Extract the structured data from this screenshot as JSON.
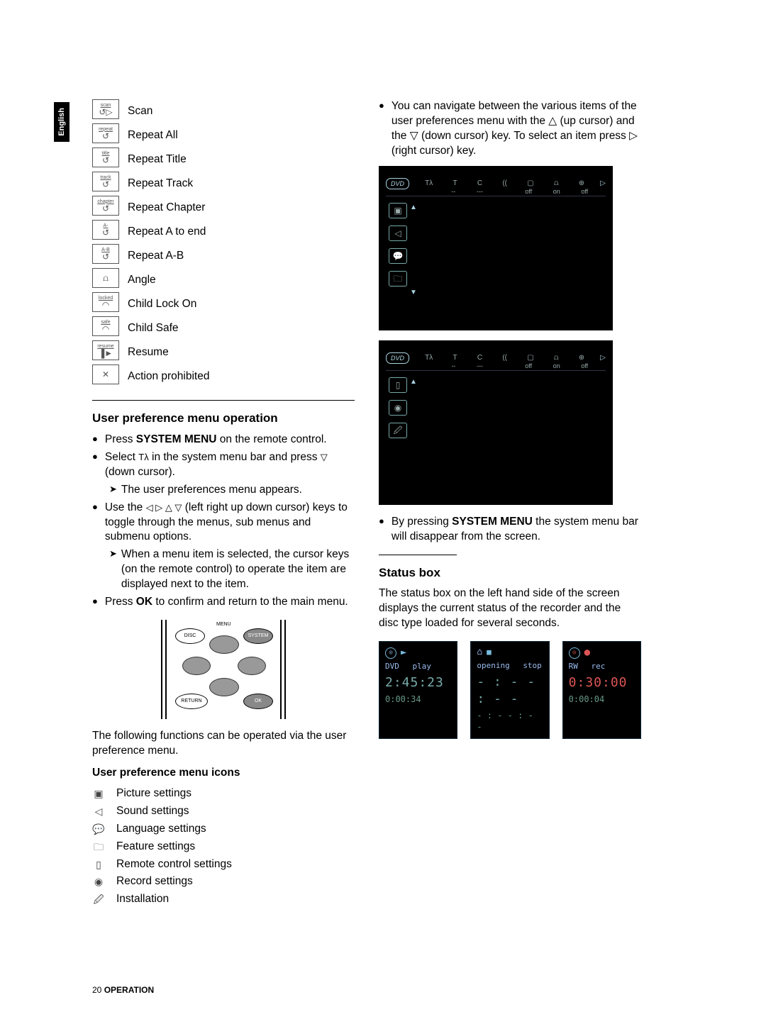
{
  "language_tab": "English",
  "icon_list": [
    {
      "box_top": "scan",
      "glyph": "↺▷",
      "label": "Scan"
    },
    {
      "box_top": "repeat",
      "glyph": "↺",
      "label": "Repeat All"
    },
    {
      "box_top": "title",
      "glyph": "↺",
      "label": "Repeat Title"
    },
    {
      "box_top": "track",
      "glyph": "↺",
      "label": "Repeat Track"
    },
    {
      "box_top": "chapter",
      "glyph": "↺",
      "label": "Repeat Chapter"
    },
    {
      "box_top": "A-",
      "glyph": "↺",
      "label": "Repeat A to end"
    },
    {
      "box_top": "A-B",
      "glyph": "↺",
      "label": "Repeat A-B"
    },
    {
      "box_top": "",
      "glyph": "⩍",
      "label": "Angle"
    },
    {
      "box_top": "locked",
      "glyph": "◠",
      "label": "Child Lock On"
    },
    {
      "box_top": "safe",
      "glyph": "◠",
      "label": "Child Safe"
    },
    {
      "box_top": "resume",
      "glyph": "▐►",
      "label": "Resume"
    },
    {
      "box_top": "",
      "glyph": "✕",
      "label": "Action prohibited"
    }
  ],
  "section_upm_title": "User preference menu operation",
  "upm_b1_a": "Press ",
  "upm_b1_b": "SYSTEM MENU",
  "upm_b1_c": " on the remote control.",
  "upm_b2_a": "Select ",
  "upm_b2_b": " in the system menu bar and press ",
  "upm_b2_c": " (down cursor).",
  "upm_b2_sub": "The user preferences menu appears.",
  "upm_b3_a": "Use the ",
  "upm_b3_b": " (left right up down cursor) keys to toggle through the menus, sub menus and submenu options.",
  "upm_b3_sub": "When a menu item is selected, the cursor keys (on the remote control) to operate the item are displayed next to the item.",
  "upm_b4_a": "Press ",
  "upm_b4_b": "OK",
  "upm_b4_c": " to confirm and return to the main menu.",
  "remote_labels": {
    "menu": "MENU",
    "disc": "DISC",
    "system": "SYSTEM",
    "return": "RETURN",
    "ok": "OK"
  },
  "upm_after_diagram": "The following functions can be operated via the user preference menu.",
  "upm_icons_title": "User preference menu icons",
  "upm_icons": [
    {
      "glyph": "▣",
      "label": "Picture settings"
    },
    {
      "glyph": "◁",
      "label": "Sound settings"
    },
    {
      "glyph": "💬",
      "label": "Language settings"
    },
    {
      "glyph": "🗀",
      "label": "Feature settings"
    },
    {
      "glyph": "▯",
      "label": "Remote control settings"
    },
    {
      "glyph": "◉",
      "label": "Record settings"
    },
    {
      "glyph": "🖉",
      "label": "Installation"
    }
  ],
  "right_b1": "You can navigate between the various items of the user preferences menu with the △ (up cursor) and the ▽ (down cursor) key. To select an item press ▷ (right cursor) key.",
  "menu_top_icons": [
    "Tλ",
    "T",
    "C",
    "((",
    "▢",
    "⩍",
    "⊕"
  ],
  "menu_top_vals": [
    "",
    "--",
    "---",
    "",
    "off",
    "on",
    "off"
  ],
  "menu_dvd": "DVD",
  "menu_side_a": [
    "▣",
    "◁",
    "💬",
    "🗀"
  ],
  "menu_side_b": [
    "▯",
    "◉",
    "🖉"
  ],
  "right_b2_a": "By pressing ",
  "right_b2_b": "SYSTEM MENU",
  "right_b2_c": " the system menu bar will disappear from the screen.",
  "status_title": "Status box",
  "status_para": "The status box on the left hand side of the screen displays the current status of the recorder and the disc type loaded for several seconds.",
  "status_boxes": [
    {
      "disc": "DVD",
      "icon": "►",
      "mode": "play",
      "big": "2:45:23",
      "sub": "0:00:34",
      "accent": false,
      "tray": false
    },
    {
      "disc": "",
      "icon": "■",
      "mode": "stop",
      "big": "- : - - : - -",
      "sub": "- : - - : - -",
      "accent": false,
      "tray": true,
      "tray_label": "opening"
    },
    {
      "disc": "RW",
      "icon": "●",
      "mode": "rec",
      "big": "0:30:00",
      "sub": "0:00:04",
      "accent": true,
      "tray": false
    }
  ],
  "footer_page": "20",
  "footer_section": "OPERATION"
}
